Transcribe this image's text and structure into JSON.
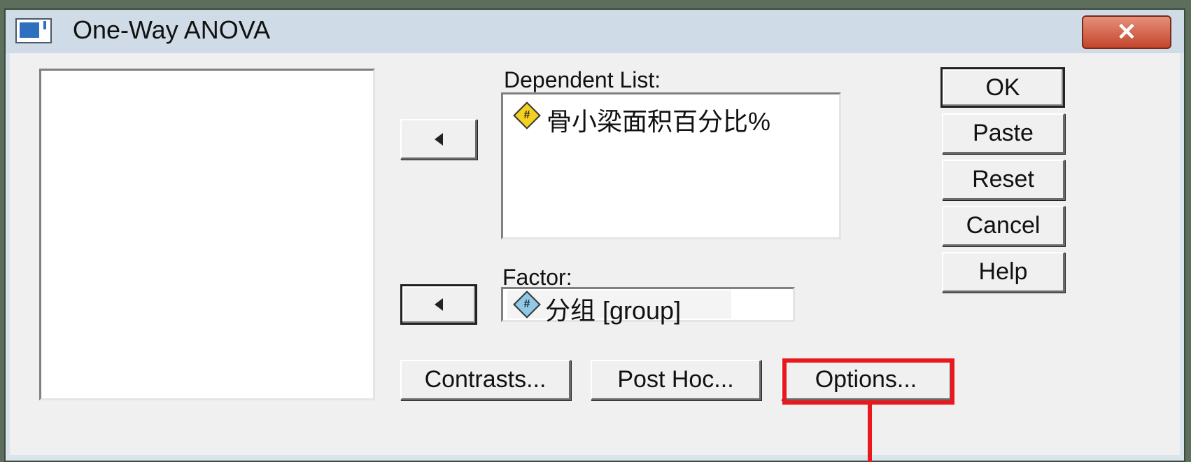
{
  "window": {
    "title": "One-Way ANOVA",
    "close_label": "✕"
  },
  "dependent_list": {
    "label": "Dependent List:",
    "items": [
      {
        "icon": "scale-variable-icon",
        "text": "骨小梁面积百分比%"
      }
    ]
  },
  "factor": {
    "label": "Factor:",
    "value": {
      "icon": "nominal-variable-icon",
      "text": "分组 [group]"
    }
  },
  "side_buttons": {
    "ok": "OK",
    "paste": "Paste",
    "reset": "Reset",
    "cancel": "Cancel",
    "help": "Help"
  },
  "bottom_buttons": {
    "contrasts": "Contrasts...",
    "post_hoc": "Post Hoc...",
    "options": "Options..."
  },
  "colors": {
    "highlight": "#e8181c",
    "scale_icon": "#f5d020",
    "nominal_icon": "#8fc9e8"
  }
}
